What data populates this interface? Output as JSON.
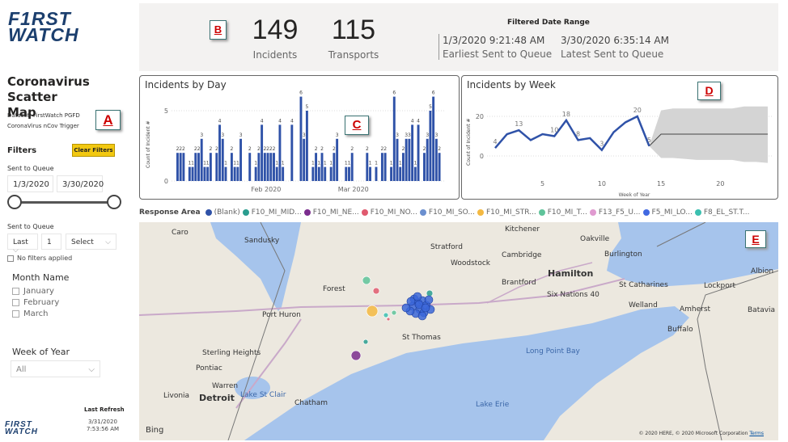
{
  "brand": {
    "logo_text": "FIRST WATCH"
  },
  "sidebar": {
    "title": "Coronavirus Scatter Map",
    "dataset_line1": "Dataset: FirstWatch PGFD",
    "dataset_line2": "CoronaVirus nCov Trigger",
    "badge": "A",
    "filters_label": "Filters",
    "clear_filters": "Clear Filters",
    "sent_to_queue_label": "Sent to Queue",
    "date_from": "1/3/2020",
    "date_to": "3/30/2020",
    "slider_range": [
      0,
      1
    ],
    "relative_label": "Sent to Queue",
    "relative_mode": "Last",
    "relative_count": "1",
    "relative_unit": "Select",
    "no_filters": "No filters applied",
    "month_label": "Month Name",
    "months": [
      "January",
      "February",
      "March"
    ],
    "week_label": "Week of Year",
    "week_value": "All",
    "last_refresh_label": "Last Refresh",
    "last_refresh_date": "3/31/2020",
    "last_refresh_time": "7:53:56 AM"
  },
  "kpis": {
    "badge": "B",
    "incidents_value": "149",
    "incidents_label": "Incidents",
    "transports_value": "115",
    "transports_label": "Transports",
    "range_title": "Filtered Date Range",
    "earliest_value": "1/3/2020 9:21:48 AM",
    "earliest_label": "Earliest Sent to Queue",
    "latest_value": "3/30/2020 6:35:14 AM",
    "latest_label": "Latest Sent to Queue"
  },
  "chart_data": [
    {
      "type": "bar",
      "title": "Incidents by Day",
      "badge": "C",
      "ylabel": "Count of Incident #",
      "xlabel": "",
      "x_tick_labels": [
        "Feb 2020",
        "Mar 2020"
      ],
      "y_ticks": [
        0,
        5
      ],
      "ylim": [
        0,
        6.5
      ],
      "grid": true,
      "color": "#2f52a8",
      "categories": [
        "1/3",
        "1/4",
        "1/5",
        "1/6",
        "1/7",
        "1/8",
        "1/9",
        "1/10",
        "1/11",
        "1/12",
        "1/13",
        "1/14",
        "1/15",
        "1/16",
        "1/17",
        "1/18",
        "1/19",
        "1/20",
        "1/21",
        "1/22",
        "1/23",
        "1/24",
        "1/25",
        "1/26",
        "1/27",
        "1/28",
        "1/29",
        "1/30",
        "1/31",
        "2/1",
        "2/2",
        "2/3",
        "2/4",
        "2/5",
        "2/6",
        "2/7",
        "2/8",
        "2/9",
        "2/10",
        "2/11",
        "2/12",
        "2/13",
        "2/14",
        "2/15",
        "2/16",
        "2/17",
        "2/18",
        "2/19",
        "2/20",
        "2/21",
        "2/22",
        "2/23",
        "2/24",
        "2/25",
        "2/26",
        "2/27",
        "2/28",
        "2/29",
        "3/1",
        "3/2",
        "3/3",
        "3/4",
        "3/5",
        "3/6",
        "3/7",
        "3/8",
        "3/9",
        "3/10",
        "3/11",
        "3/12",
        "3/13",
        "3/14",
        "3/15",
        "3/16",
        "3/17",
        "3/18",
        "3/19",
        "3/20",
        "3/21",
        "3/22",
        "3/23",
        "3/24",
        "3/25",
        "3/26",
        "3/27",
        "3/28",
        "3/29",
        "3/30"
      ],
      "values": [
        2,
        2,
        2,
        0,
        1,
        1,
        2,
        2,
        3,
        1,
        1,
        2,
        0,
        2,
        4,
        3,
        1,
        0,
        2,
        1,
        1,
        3,
        0,
        0,
        2,
        0,
        1,
        2,
        4,
        2,
        2,
        2,
        2,
        1,
        4,
        1,
        0,
        0,
        4,
        0,
        0,
        6,
        3,
        5,
        0,
        1,
        2,
        1,
        2,
        1,
        0,
        1,
        2,
        3,
        0,
        0,
        1,
        1,
        2,
        0,
        0,
        0,
        0,
        2,
        1,
        0,
        1,
        0,
        2,
        2,
        0,
        1,
        6,
        3,
        1,
        2,
        3,
        3,
        4,
        1,
        4,
        0,
        2,
        3,
        5,
        6,
        3,
        2
      ]
    },
    {
      "type": "line",
      "title": "Incidents by Week",
      "badge": "D",
      "ylabel": "Count of Incident #",
      "xlabel": "Week of Year",
      "x_ticks": [
        5,
        10,
        15,
        20
      ],
      "y_ticks": [
        0,
        20
      ],
      "xlim": [
        1,
        24
      ],
      "ylim": [
        -5,
        25
      ],
      "grid": true,
      "color": "#2f52a8",
      "x": [
        1,
        2,
        3,
        4,
        5,
        6,
        7,
        8,
        9,
        10,
        11,
        12,
        13,
        14
      ],
      "values": [
        4,
        11,
        13,
        8,
        11,
        10,
        18,
        8,
        9,
        3,
        12,
        17,
        20,
        5
      ],
      "data_labels": {
        "1": "4",
        "3": "13",
        "6": "10",
        "7": "18",
        "8": "8",
        "10": "3",
        "13": "20",
        "14": "5"
      },
      "forecast": {
        "x": [
          14,
          15,
          16,
          17,
          18,
          19,
          20,
          21,
          22,
          23,
          24
        ],
        "values": [
          5,
          11,
          11,
          11,
          11,
          11,
          11,
          11,
          11,
          11,
          11
        ],
        "upper": [
          5,
          23,
          24,
          24,
          24,
          24,
          24,
          24,
          25,
          25,
          25
        ],
        "lower": [
          5,
          -1,
          -1,
          -1.5,
          -2,
          -2,
          -2,
          -2,
          -3,
          -3,
          -3.5
        ],
        "band_color": "#d4d4d4"
      }
    }
  ],
  "map": {
    "badge": "E",
    "legend_title": "Response Area",
    "legend": [
      {
        "label": "(Blank)",
        "color": "#2f52a8"
      },
      {
        "label": "F10_MI_MID...",
        "color": "#2a9d8f"
      },
      {
        "label": "F10_MI_NE...",
        "color": "#7b2d8e"
      },
      {
        "label": "F10_MI_NO...",
        "color": "#e05a6f"
      },
      {
        "label": "F10_MI_SO...",
        "color": "#6b8fcf"
      },
      {
        "label": "F10_MI_STR...",
        "color": "#f4b942"
      },
      {
        "label": "F10_MI_T...",
        "color": "#5fc39a"
      },
      {
        "label": "F13_F5_U...",
        "color": "#e09ad0"
      },
      {
        "label": "F5_MI_LO...",
        "color": "#4169e1"
      },
      {
        "label": "F8_EL_ST.T...",
        "color": "#3cc0b0"
      }
    ],
    "places": [
      "Caro",
      "Sandusky",
      "Kitchener",
      "Oakville",
      "Stratford",
      "Cambridge",
      "Burlington",
      "Hamilton",
      "Woodstock",
      "Brantford",
      "Six Nations 40",
      "St Catharines",
      "Lockport",
      "Albion",
      "Forest",
      "Port Huron",
      "Welland",
      "Amherst",
      "Batavia",
      "Buffalo",
      "St Thomas",
      "Long Point Bay",
      "Sterling Heights",
      "Pontiac",
      "Warren",
      "Livonia",
      "Detroit",
      "Lake St Clair",
      "Chatham",
      "Lake Erie"
    ],
    "bing": "Bing",
    "copyright": "© 2020 HERE, © 2020 Microsoft Corporation",
    "terms": "Terms"
  }
}
